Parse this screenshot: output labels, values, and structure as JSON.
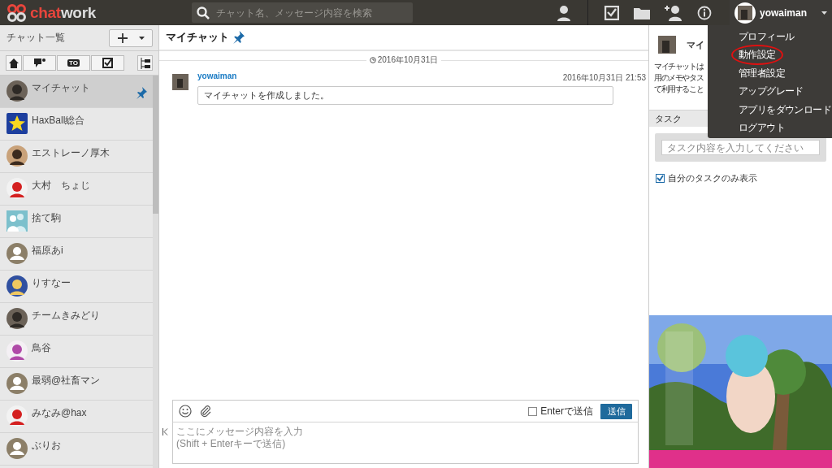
{
  "header": {
    "logo": [
      "chat",
      "work"
    ],
    "search": {
      "placeholder": "チャット名、メッセージ内容を検索"
    },
    "user": {
      "name": "yowaiman",
      "menu_open": true
    }
  },
  "menu": [
    {
      "label": "プロフィール",
      "circled": false
    },
    {
      "label": "動作設定",
      "circled": true
    },
    {
      "label": "管理者設定",
      "circled": false
    },
    {
      "label": "アップグレード",
      "circled": false
    },
    {
      "label": "アプリをダウンロード",
      "circled": false
    },
    {
      "label": "ログアウト",
      "circled": false
    }
  ],
  "sidebar": {
    "title": "チャット一覧",
    "filters": [
      {
        "kind": "home"
      },
      {
        "kind": "mention"
      },
      {
        "kind": "to",
        "label": "TO"
      },
      {
        "kind": "task"
      }
    ],
    "rooms": [
      {
        "name": "マイチャット",
        "selected": true,
        "pinned": true
      },
      {
        "name": "HaxBall総合",
        "avatar": {
          "kind": "star"
        },
        "selected": false,
        "pinned": false
      },
      {
        "name": "エストレーノ厚木",
        "selected": false,
        "pinned": false
      },
      {
        "name": "大村　ちょじ",
        "selected": false,
        "pinned": false
      },
      {
        "name": "捨て駒",
        "avatar": {
          "kind": "group"
        },
        "selected": false,
        "pinned": false
      },
      {
        "name": "福原あi",
        "avatar": {
          "kind": "default"
        },
        "selected": false,
        "pinned": false
      },
      {
        "name": "りすなー",
        "selected": false,
        "pinned": false
      },
      {
        "name": "チームきみどり",
        "selected": false,
        "pinned": false
      },
      {
        "name": "鳥谷",
        "selected": false,
        "pinned": false
      },
      {
        "name": "最弱@社畜マン",
        "avatar": {
          "kind": "default"
        },
        "selected": false,
        "pinned": false
      },
      {
        "name": "みなみ@hax",
        "selected": false,
        "pinned": false
      },
      {
        "name": "ぶりお",
        "avatar": {
          "kind": "default"
        },
        "selected": false,
        "pinned": false
      }
    ]
  },
  "chat": {
    "title": "マイチャット",
    "pinned": true,
    "date": "2016年10月31日",
    "messages": [
      {
        "author": "yowaiman",
        "time": "2016年10月31日 21:53",
        "text": "マイチャットを作成しました。"
      }
    ]
  },
  "composer": {
    "enter_to_send": {
      "label": "Enterで送信",
      "checked": false
    },
    "send": "送信",
    "placeholder": "ここにメッセージ内容を入力\n(Shift + Enterキーで送信)"
  },
  "info": {
    "title": "マイ",
    "lines": [
      "マイチャットは",
      "用のメモやタス",
      "て利用すること"
    ]
  },
  "tasks": {
    "title": "タスク",
    "placeholder": "タスク内容を入力してください",
    "mine_only": {
      "label": "自分のタスクのみ表示",
      "checked": true
    }
  }
}
